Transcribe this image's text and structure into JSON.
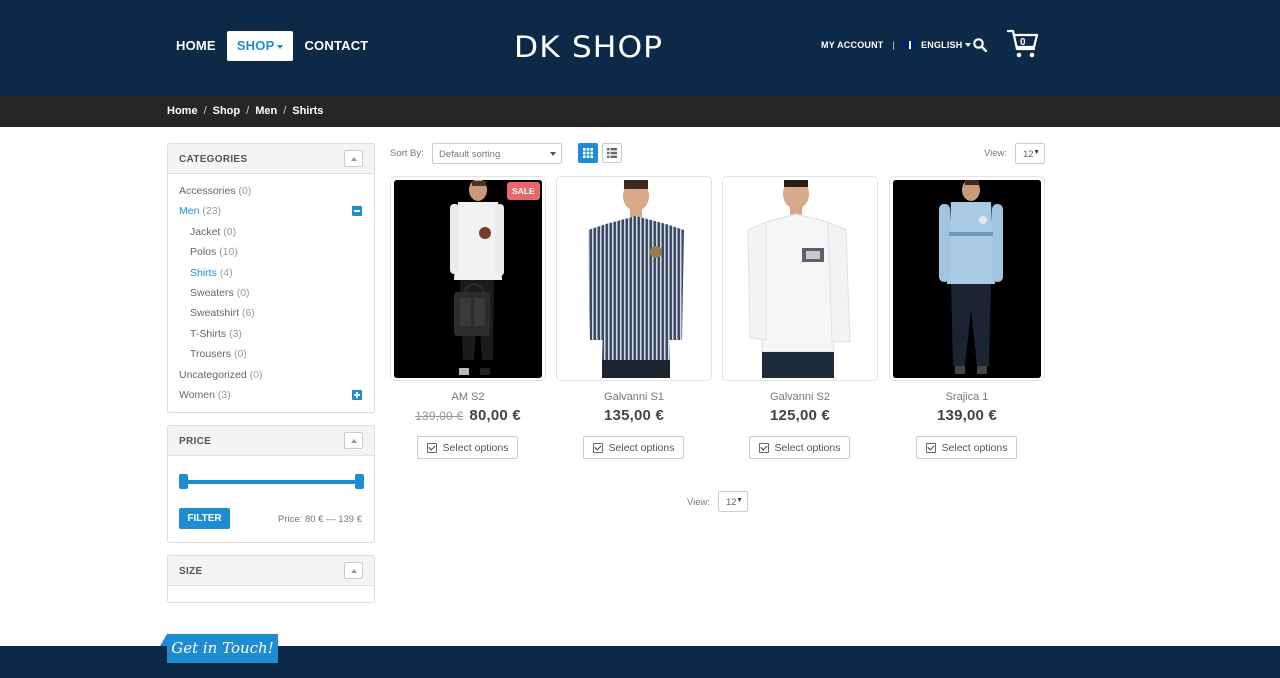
{
  "header": {
    "nav": [
      {
        "label": "HOME"
      },
      {
        "label": "SHOP"
      },
      {
        "label": "CONTACT"
      }
    ],
    "logo": "DK SHOP",
    "account": "MY ACCOUNT",
    "language": "ENGLISH",
    "cart_count": "0",
    "colors": {
      "header_bg": "#0c2a47",
      "accent": "#1e8cd3"
    }
  },
  "breadcrumb": [
    "Home",
    "Shop",
    "Men",
    "Shirts"
  ],
  "sidebar": {
    "categories": {
      "title": "CATEGORIES",
      "items": [
        {
          "label": "Accessories",
          "count": "(0)"
        },
        {
          "label": "Men",
          "count": "(23)"
        },
        {
          "label": "Jacket",
          "count": "(0)"
        },
        {
          "label": "Polos",
          "count": "(10)"
        },
        {
          "label": "Shirts",
          "count": "(4)"
        },
        {
          "label": "Sweaters",
          "count": "(0)"
        },
        {
          "label": "Sweatshirt",
          "count": "(6)"
        },
        {
          "label": "T-Shirts",
          "count": "(3)"
        },
        {
          "label": "Trousers",
          "count": "(0)"
        },
        {
          "label": "Uncategorized",
          "count": "(0)"
        },
        {
          "label": "Women",
          "count": "(3)"
        }
      ]
    },
    "price": {
      "title": "PRICE",
      "filter_label": "FILTER",
      "range_text": "Price: 80 € — 139 €"
    },
    "size": {
      "title": "SIZE"
    }
  },
  "toolbar": {
    "sort_label": "Sort By:",
    "sort_value": "Default sorting",
    "view_label": "View:",
    "view_value": "12"
  },
  "products": [
    {
      "name": "AM S2",
      "old_price": "139,00 €",
      "price": "80,00 €",
      "badge": "SALE",
      "button": "Select options"
    },
    {
      "name": "Galvanni S1",
      "price": "135,00 €",
      "button": "Select options"
    },
    {
      "name": "Galvanni S2",
      "price": "125,00 €",
      "button": "Select options"
    },
    {
      "name": "Srajica 1",
      "price": "139,00 €",
      "button": "Select options"
    }
  ],
  "bottom_view": {
    "label": "View:",
    "value": "12"
  },
  "footer": {
    "tab_label": "Get in Touch!"
  }
}
